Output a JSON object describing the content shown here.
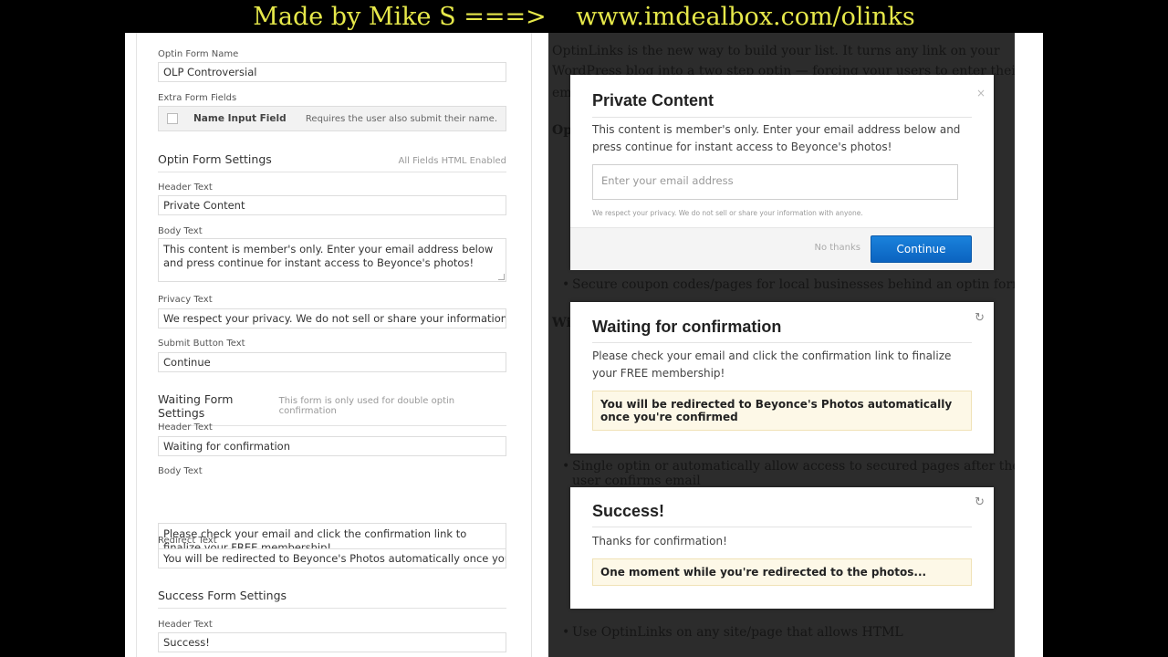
{
  "banner": {
    "left": "Made by Mike S ===>",
    "right": "www.imdealbox.com/olinks"
  },
  "form": {
    "optin_name_label": "Optin Form Name",
    "optin_name_value": "OLP Controversial",
    "extra_fields_label": "Extra Form Fields",
    "extra_field_name": "Name Input Field",
    "extra_field_desc": "Requires the user also submit their name.",
    "optin_settings_title": "Optin Form Settings",
    "optin_settings_hint": "All Fields HTML Enabled",
    "header_label": "Header Text",
    "optin_header_value": "Private Content",
    "body_label": "Body Text",
    "optin_body_value": "This content is member's only. Enter your email address below and press continue for instant access to Beyonce's photos!",
    "privacy_label": "Privacy Text",
    "privacy_value": "We respect your privacy. We do not sell or share your information with",
    "submit_label": "Submit Button Text",
    "submit_value": "Continue",
    "waiting_settings_title": "Waiting Form Settings",
    "waiting_settings_hint": "This form is only used for double optin confirmation",
    "waiting_header_value": "Waiting for confirmation",
    "waiting_body_value": "Please check your email and click the confirmation link to finalize your FREE membership!",
    "redirect_label": "Redirect Text",
    "redirect_value": "You will be redirected to Beyonce's Photos automatically once you're cc",
    "success_settings_title": "Success Form Settings",
    "success_header_value": "Success!"
  },
  "background": {
    "para_lines": [
      "OptinLinks is the new way to build your list. It turns any link on your",
      "WordPress blog into a two step optin — forcing your users to enter their",
      "em"
    ],
    "heading_op": "Op",
    "heading_wi": "Wi",
    "bullet_coupon": "Secure coupon codes/pages for local businesses behind an optin form",
    "bullet_single_1": "Single optin or automatically allow access to secured pages after the",
    "bullet_single_2": "user confirms email",
    "bullet_html": "Use OptinLinks on any site/page that allows HTML"
  },
  "optin_modal": {
    "title": "Private Content",
    "body": "This content is member's only. Enter your email address below and press continue for instant access to Beyonce's photos!",
    "email_placeholder": "Enter your email address",
    "privacy": "We respect your privacy. We do not sell or share your information with anyone.",
    "no_thanks": "No thanks",
    "continue": "Continue",
    "close": "×"
  },
  "waiting_modal": {
    "title": "Waiting for confirmation",
    "body": "Please check your email and click the confirmation link to finalize your FREE membership!",
    "notice": "You will be redirected to Beyonce's Photos automatically once you're confirmed"
  },
  "success_modal": {
    "title": "Success!",
    "body": "Thanks for confirmation!",
    "notice": "One moment while you're redirected to the photos..."
  },
  "colors": {
    "banner_text": "#e6e84a",
    "button_blue": "#0b6fcf",
    "notice_bg": "#fdf8e7"
  }
}
